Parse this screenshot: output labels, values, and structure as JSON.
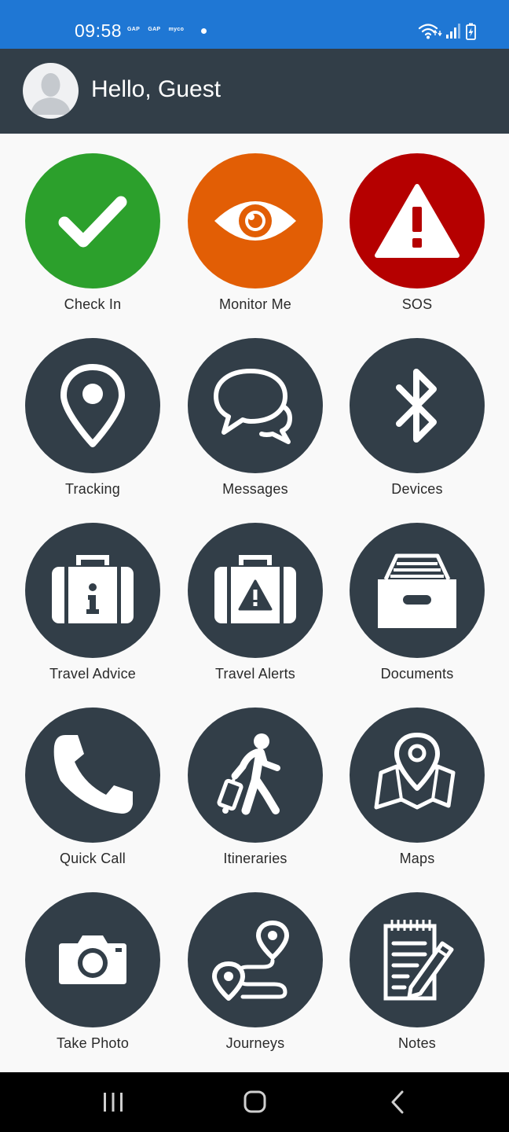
{
  "status_bar": {
    "time": "09:58",
    "notifications": [
      "GAP",
      "GAP",
      "myco"
    ],
    "background": "#1f77d4"
  },
  "header": {
    "greeting": "Hello, Guest",
    "background": "#323e48"
  },
  "tiles": [
    {
      "label": "Check In",
      "icon": "checkmark-icon",
      "color": "#2ca02c"
    },
    {
      "label": "Monitor Me",
      "icon": "eye-icon",
      "color": "#e25e05"
    },
    {
      "label": "SOS",
      "icon": "warning-icon",
      "color": "#b50000"
    },
    {
      "label": "Tracking",
      "icon": "location-pin-icon",
      "color": "#323e48"
    },
    {
      "label": "Messages",
      "icon": "chat-bubbles-icon",
      "color": "#323e48"
    },
    {
      "label": "Devices",
      "icon": "bluetooth-icon",
      "color": "#323e48"
    },
    {
      "label": "Travel Advice",
      "icon": "suitcase-info-icon",
      "color": "#323e48"
    },
    {
      "label": "Travel Alerts",
      "icon": "suitcase-alert-icon",
      "color": "#323e48"
    },
    {
      "label": "Documents",
      "icon": "archive-box-icon",
      "color": "#323e48"
    },
    {
      "label": "Quick Call",
      "icon": "phone-icon",
      "color": "#323e48"
    },
    {
      "label": "Itineraries",
      "icon": "traveler-luggage-icon",
      "color": "#323e48"
    },
    {
      "label": "Maps",
      "icon": "map-pin-icon",
      "color": "#323e48"
    },
    {
      "label": "Take Photo",
      "icon": "camera-icon",
      "color": "#323e48"
    },
    {
      "label": "Journeys",
      "icon": "route-icon",
      "color": "#323e48"
    },
    {
      "label": "Notes",
      "icon": "notepad-pencil-icon",
      "color": "#323e48"
    }
  ],
  "nav_bar": {
    "buttons": [
      "recent-apps-icon",
      "home-icon",
      "back-icon"
    ]
  }
}
